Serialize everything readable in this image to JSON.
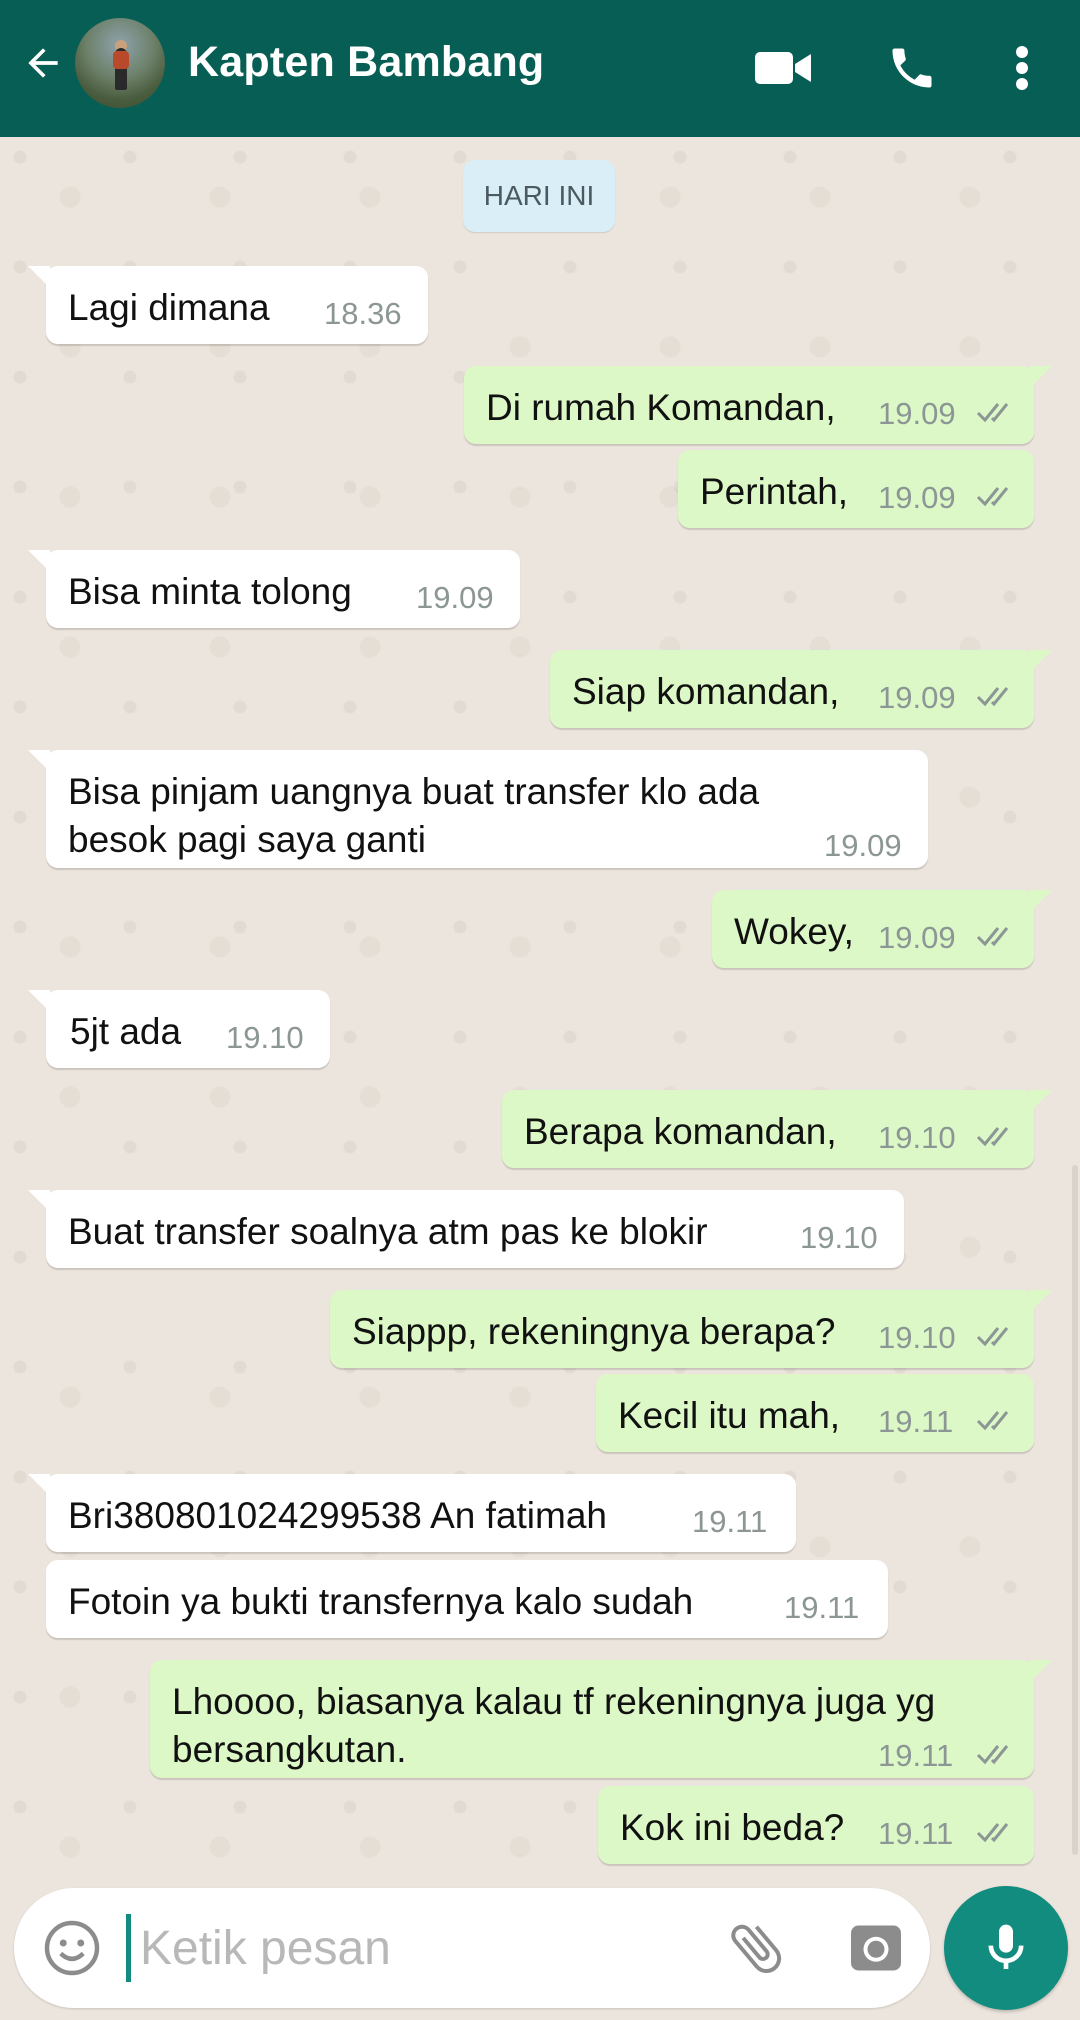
{
  "header": {
    "contact_name": "Kapten Bambang",
    "icons": [
      "back-arrow-icon",
      "video-call-icon",
      "phone-icon",
      "more-vert-icon"
    ],
    "bg_color": "#075e54"
  },
  "date_chip": "HARI INI",
  "messages": [
    {
      "dir": "in",
      "text": "Lagi dimana",
      "time": "18.36"
    },
    {
      "dir": "out",
      "text": "Di rumah Komandan,",
      "time": "19.09",
      "status": "read"
    },
    {
      "dir": "out",
      "text": "Perintah,",
      "time": "19.09",
      "status": "read"
    },
    {
      "dir": "in",
      "text": "Bisa minta tolong",
      "time": "19.09"
    },
    {
      "dir": "out",
      "text": "Siap komandan,",
      "time": "19.09",
      "status": "read"
    },
    {
      "dir": "in",
      "text": "Bisa pinjam uangnya buat transfer klo ada besok pagi saya ganti",
      "time": "19.09"
    },
    {
      "dir": "out",
      "text": "Wokey,",
      "time": "19.09",
      "status": "read"
    },
    {
      "dir": "in",
      "text": "5jt ada",
      "time": "19.10"
    },
    {
      "dir": "out",
      "text": "Berapa komandan,",
      "time": "19.10",
      "status": "read"
    },
    {
      "dir": "in",
      "text": "Buat transfer soalnya atm pas ke blokir",
      "time": "19.10"
    },
    {
      "dir": "out",
      "text": "Siappp, rekeningnya berapa?",
      "time": "19.10",
      "status": "read"
    },
    {
      "dir": "out",
      "text": "Kecil itu mah,",
      "time": "19.11",
      "status": "read"
    },
    {
      "dir": "in",
      "text": "Bri380801024299538 An fatimah",
      "time": "19.11"
    },
    {
      "dir": "in",
      "text": "Fotoin ya bukti transfernya kalo sudah",
      "time": "19.11"
    },
    {
      "dir": "out",
      "text": "Lhoooo, biasanya kalau tf rekeningnya juga yg bersangkutan.",
      "time": "19.11",
      "status": "read"
    },
    {
      "dir": "out",
      "text": "Kok ini beda?",
      "time": "19.11",
      "status": "read"
    }
  ],
  "input": {
    "placeholder": "Ketik pesan",
    "value": ""
  },
  "colors": {
    "incoming_bubble": "#ffffff",
    "outgoing_bubble": "#dcf8c6",
    "chat_bg": "#ece5dd",
    "accent": "#128c7e",
    "read_ticks": "#8c9795"
  }
}
